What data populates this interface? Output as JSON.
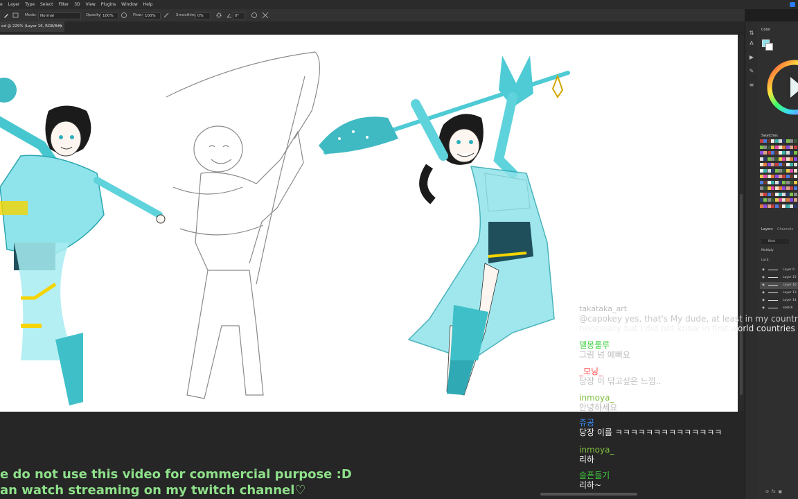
{
  "menu": [
    "e",
    "Layer",
    "Type",
    "Select",
    "Filter",
    "3D",
    "View",
    "Plugins",
    "Window",
    "Help"
  ],
  "options": {
    "mode_label": "Mode:",
    "mode_value": "Normal",
    "opacity_label": "Opacity:",
    "opacity_value": "100%",
    "flow_label": "Flow:",
    "flow_value": "100%",
    "smoothing_label": "Smoothing:",
    "smoothing_value": "0%",
    "angle_value": "0°"
  },
  "tab": {
    "title": "ed @ 229% (Layer 16, RGB/8#) *",
    "close": "×"
  },
  "panels": {
    "color": "Color",
    "swatches": "Swatches",
    "layers": "Layers",
    "channels": "Channels",
    "kind": "Kind",
    "blend": "Multiply",
    "lock": "Lock:",
    "layer_names": [
      "Layer 9",
      "Layer 15",
      "Layer 16",
      "Layer 13",
      "Layer 14",
      "sketch"
    ]
  },
  "chat": [
    {
      "user": "takataka_art",
      "text": "@capokey yes, that's My dude, at least in my country it's",
      "text2": "necessary but I did not know in first world countries",
      "color": "#bdbdbd"
    },
    {
      "user": "델몽룰루",
      "text": "그림 넘 예뻐요",
      "color": "#3ecf3e"
    },
    {
      "user": "_모닝_",
      "text": "당장 이 닦고싶은 느낌..",
      "color": "#ff4a4a"
    },
    {
      "user": "inmoya_",
      "text": "안녕하세요",
      "color": "#7fbf3f"
    },
    {
      "user": "쥬공",
      "text": "당장 이를 ㅋㅋㅋㅋㅋㅋㅋㅋㅋㅋㅋㅋㅋㅋ",
      "color": "#3a8fff"
    },
    {
      "user": "inmoya_",
      "text": "리하",
      "color": "#7fbf3f"
    },
    {
      "user": "슬픈들기",
      "text": "리하~",
      "color": "#3ecf3e"
    }
  ],
  "watermark": {
    "line1": "e do not use this video for commercial purpose :D",
    "line2": "an watch streaming on my twitch channel♡"
  },
  "colors": {
    "accent_teal": "#5fd3dc",
    "canvas": "#ffffff",
    "chrome": "#2b2b2b"
  }
}
